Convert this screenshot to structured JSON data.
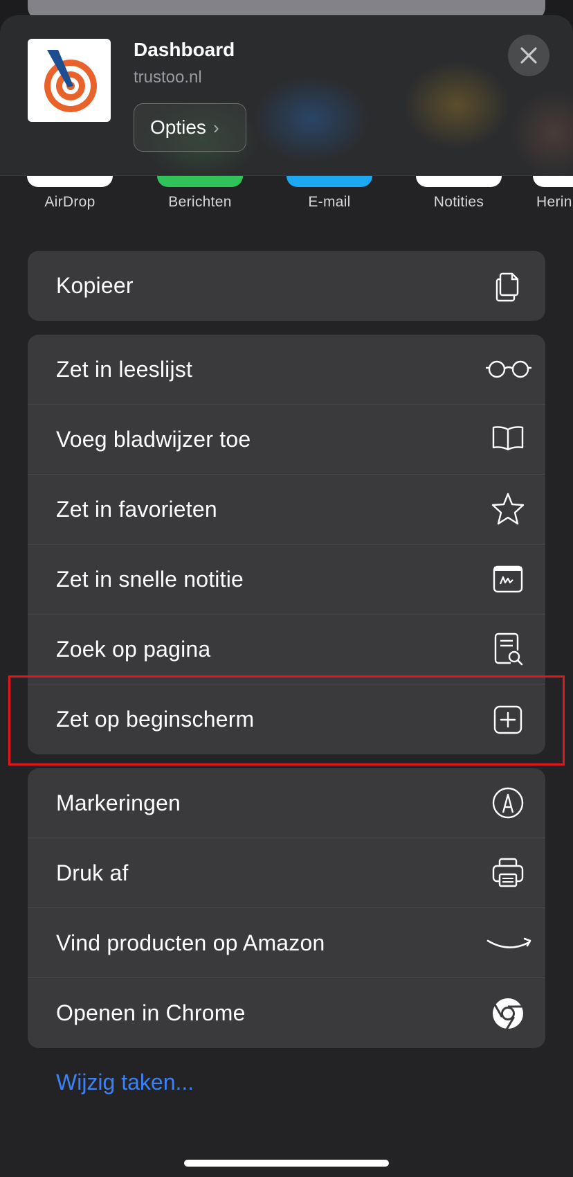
{
  "header": {
    "title": "Dashboard",
    "subtitle": "trustoo.nl",
    "options_label": "Opties",
    "options_chevron": "›"
  },
  "share_targets": [
    {
      "label": "AirDrop",
      "color": "#ffffff"
    },
    {
      "label": "Berichten",
      "color": "#30c35a"
    },
    {
      "label": "E-mail",
      "color": "#1ea7f2"
    },
    {
      "label": "Notities",
      "color": "#ffffff"
    },
    {
      "label": "Herin",
      "color": "#ffffff"
    }
  ],
  "group1": [
    {
      "label": "Kopieer",
      "icon": "copy-icon"
    }
  ],
  "group2": [
    {
      "label": "Zet in leeslijst",
      "icon": "glasses-icon"
    },
    {
      "label": "Voeg bladwijzer toe",
      "icon": "book-icon"
    },
    {
      "label": "Zet in favorieten",
      "icon": "star-icon"
    },
    {
      "label": "Zet in snelle notitie",
      "icon": "quick-note-icon"
    },
    {
      "label": "Zoek op pagina",
      "icon": "find-on-page-icon"
    },
    {
      "label": "Zet op beginscherm",
      "icon": "add-square-icon"
    }
  ],
  "group3": [
    {
      "label": "Markeringen",
      "icon": "markup-icon"
    },
    {
      "label": "Druk af",
      "icon": "printer-icon"
    },
    {
      "label": "Vind producten op Amazon",
      "icon": "amazon-icon"
    },
    {
      "label": "Openen in Chrome",
      "icon": "chrome-icon"
    }
  ],
  "edit_actions_label": "Wijzig taken...",
  "colors": {
    "accent_link": "#3b82f6",
    "highlight": "#e0171f",
    "row_bg": "#3a3a3c"
  }
}
